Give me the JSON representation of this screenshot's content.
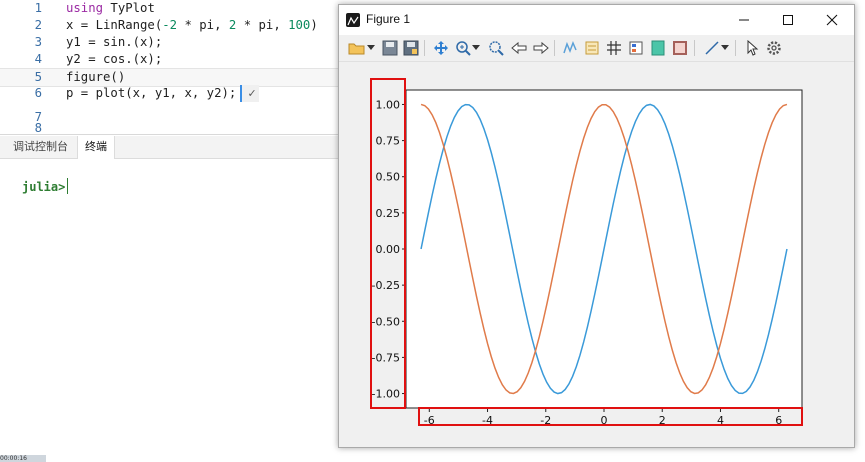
{
  "editor": {
    "lines": [
      {
        "num": "1",
        "parts": [
          {
            "t": "using",
            "c": "kw"
          },
          {
            "t": " TyPlot",
            "c": ""
          }
        ]
      },
      {
        "num": "2",
        "parts": [
          {
            "t": "x = LinRange(",
            "c": ""
          },
          {
            "t": "-2",
            "c": "num"
          },
          {
            "t": " * pi, ",
            "c": ""
          },
          {
            "t": "2",
            "c": "num"
          },
          {
            "t": " * pi, ",
            "c": ""
          },
          {
            "t": "100",
            "c": "num"
          },
          {
            "t": ")",
            "c": ""
          }
        ]
      },
      {
        "num": "3",
        "parts": [
          {
            "t": "y1 = sin.(x);",
            "c": ""
          }
        ]
      },
      {
        "num": "4",
        "parts": [
          {
            "t": "y2 = cos.(x);",
            "c": ""
          }
        ]
      },
      {
        "num": "5",
        "parts": [
          {
            "t": "figure()",
            "c": ""
          }
        ]
      },
      {
        "num": "6",
        "parts": [
          {
            "t": "p = plot(x, y1, x, y2);",
            "c": ""
          }
        ]
      },
      {
        "num": "7",
        "parts": []
      },
      {
        "num": "8",
        "parts": []
      }
    ],
    "active_line_index": 4,
    "inline_result": "✓"
  },
  "panel": {
    "tabs": [
      "调试控制台",
      "终端"
    ],
    "active_tab": 1,
    "prompt": "julia>"
  },
  "status_text": "00:00:16",
  "figure_window": {
    "title": "Figure 1",
    "controls": {
      "minimize": "minimize-icon",
      "maximize": "maximize-icon",
      "close": "close-icon"
    },
    "toolbar_icons": [
      "open-folder-icon",
      "save-icon",
      "save-as-icon",
      "pan-icon",
      "zoom-in-icon",
      "zoom-fit-icon",
      "back-icon",
      "forward-icon",
      "data-cursor-icon",
      "legend-icon",
      "grid-icon",
      "colorbar-icon",
      "fill-icon",
      "frame-icon",
      "line-tool-icon",
      "select-pointer-icon",
      "settings-gear-icon"
    ]
  },
  "chart_data": {
    "type": "line",
    "x_range": [
      -6.283,
      6.283
    ],
    "xlim": [
      -6.8,
      6.8
    ],
    "ylim": [
      -1.1,
      1.1
    ],
    "xticks": [
      -6,
      -4,
      -2,
      0,
      2,
      4,
      6
    ],
    "xtick_labels": [
      "-6",
      "-4",
      "-2",
      "0",
      "2",
      "4",
      "6"
    ],
    "yticks": [
      1.0,
      0.75,
      0.5,
      0.25,
      0.0,
      -0.25,
      -0.5,
      -0.75,
      -1.0
    ],
    "ytick_labels": [
      "1.00",
      "0.75",
      "0.50",
      "0.25",
      "0.00",
      "-0.25",
      "-0.50",
      "-0.75",
      "-1.00"
    ],
    "samples": 100,
    "series": [
      {
        "function": "sin",
        "color": "#3a9ad9"
      },
      {
        "function": "cos",
        "color": "#e07b4a"
      }
    ],
    "grid": false,
    "highlight_color": "#e01010"
  }
}
